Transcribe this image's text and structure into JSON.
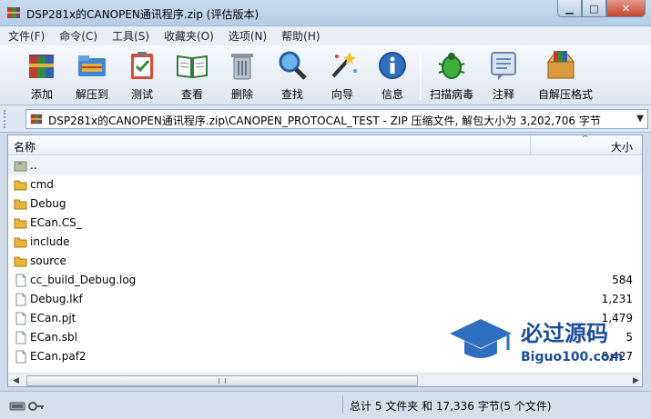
{
  "window": {
    "title": "DSP281x的CANOPEN通讯程序.zip (评估版本)"
  },
  "menu": [
    {
      "label": "文件(F)"
    },
    {
      "label": "命令(C)"
    },
    {
      "label": "工具(S)"
    },
    {
      "label": "收藏夹(O)"
    },
    {
      "label": "选项(N)"
    },
    {
      "label": "帮助(H)"
    }
  ],
  "toolbar": {
    "add": "添加",
    "extract": "解压到",
    "test": "测试",
    "view": "查看",
    "delete": "删除",
    "find": "查找",
    "wizard": "向导",
    "info": "信息",
    "virus_scan": "扫描病毒",
    "comment": "注释",
    "sfx": "自解压格式"
  },
  "address": {
    "path": "DSP281x的CANOPEN通讯程序.zip\\CANOPEN_PROTOCAL_TEST - ZIP 压缩文件, 解包大小为 3,202,706 字节"
  },
  "columns": {
    "name": "名称",
    "size": "大小"
  },
  "files": [
    {
      "name": "..",
      "type": "parent",
      "size": ""
    },
    {
      "name": "cmd",
      "type": "folder",
      "size": ""
    },
    {
      "name": "Debug",
      "type": "folder",
      "size": ""
    },
    {
      "name": "ECan.CS_",
      "type": "folder",
      "size": ""
    },
    {
      "name": "include",
      "type": "folder",
      "size": ""
    },
    {
      "name": "source",
      "type": "folder",
      "size": ""
    },
    {
      "name": "cc_build_Debug.log",
      "type": "file",
      "size": "584"
    },
    {
      "name": "Debug.lkf",
      "type": "file",
      "size": "1,231"
    },
    {
      "name": "ECan.pjt",
      "type": "file",
      "size": "1,479"
    },
    {
      "name": "ECan.sbl",
      "type": "file",
      "size": "5"
    },
    {
      "name": "ECan.paf2",
      "type": "file",
      "size": "8,427"
    }
  ],
  "status": {
    "summary": "总计 5 文件夹 和 17,336 字节(5 个文件)"
  },
  "watermark": {
    "brand": "必过源码",
    "url": "Biguo100.com"
  },
  "colors": {
    "folder": "#e8b635",
    "accent": "#2f6fc0"
  }
}
